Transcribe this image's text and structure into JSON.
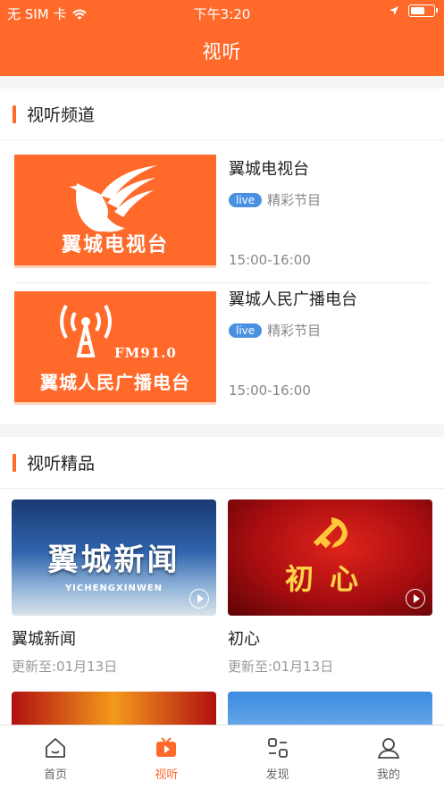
{
  "status_bar": {
    "carrier": "无 SIM 卡",
    "time": "下午3:20",
    "icons": [
      "wifi-icon",
      "location-arrow-icon",
      "battery-icon"
    ]
  },
  "nav": {
    "title": "视听"
  },
  "channels_section": {
    "title": "视听频道",
    "items": [
      {
        "name": "翼城电视台",
        "badge": "live",
        "tag": "精彩节目",
        "time": "15:00-16:00",
        "thumb_caption": "翼城电视台"
      },
      {
        "name": "翼城人民广播电台",
        "badge": "live",
        "tag": "精彩节目",
        "time": "15:00-16:00",
        "thumb_caption": "翼城人民广播电台",
        "thumb_freq": "FM91.0"
      }
    ]
  },
  "quality_section": {
    "title": "视听精品",
    "items": [
      {
        "title": "翼城新闻",
        "updated": "更新至:01月13日",
        "thumb_text": "翼城新闻",
        "thumb_subtext": "YICHENGXINWEN"
      },
      {
        "title": "初心",
        "updated": "更新至:01月13日",
        "thumb_text": "初心"
      },
      {
        "title": "",
        "updated": ""
      },
      {
        "title": "",
        "updated": ""
      }
    ]
  },
  "tabbar": {
    "items": [
      {
        "label": "首页",
        "icon": "home-icon",
        "active": false
      },
      {
        "label": "视听",
        "icon": "tv-play-icon",
        "active": true
      },
      {
        "label": "发现",
        "icon": "discover-icon",
        "active": false
      },
      {
        "label": "我的",
        "icon": "user-icon",
        "active": false
      }
    ]
  },
  "colors": {
    "accent": "#ff6a2b",
    "live_badge": "#4a90e2"
  }
}
